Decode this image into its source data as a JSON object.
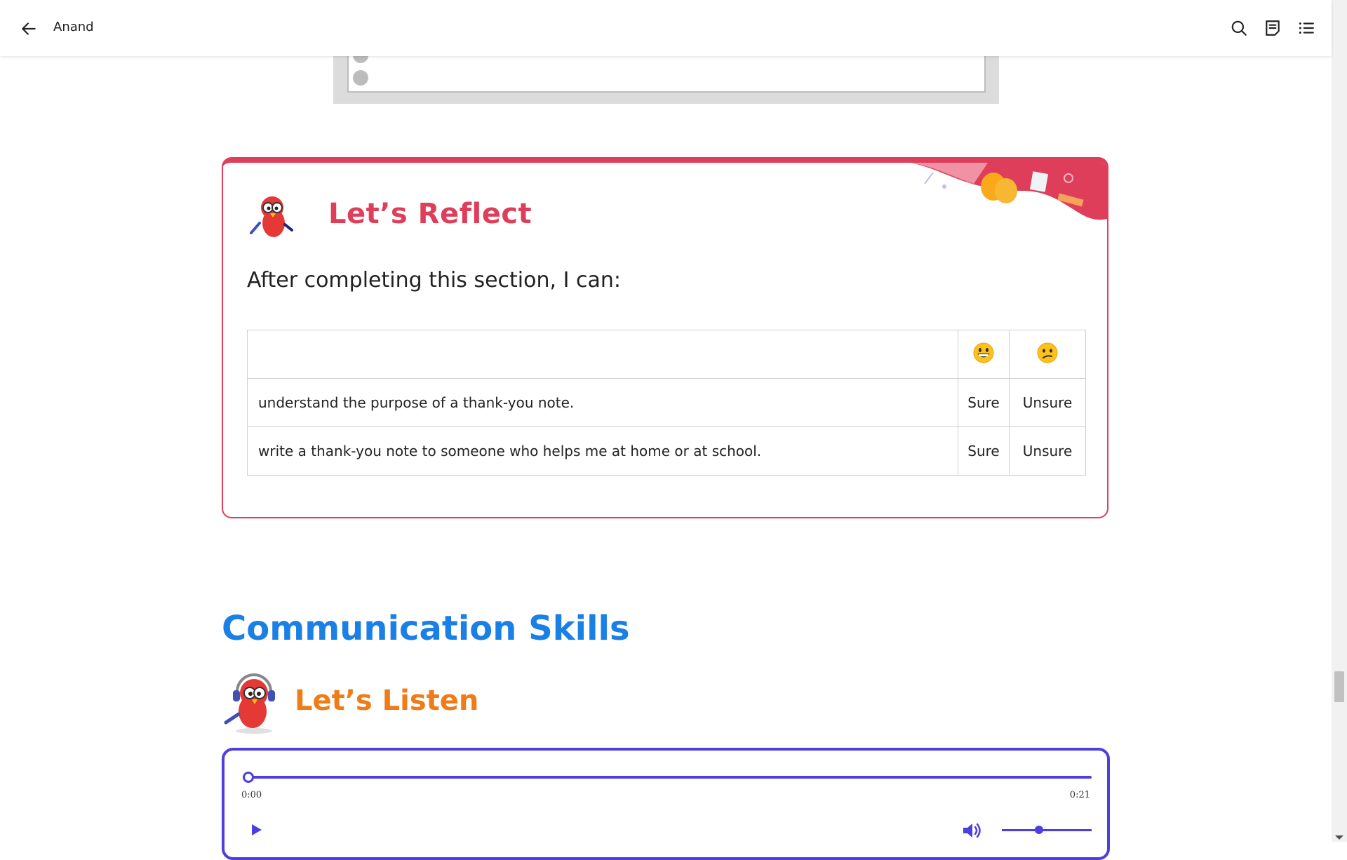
{
  "header": {
    "title": "Anand",
    "icons": [
      "back-arrow-icon",
      "search-icon",
      "notes-icon",
      "table-of-contents-icon"
    ]
  },
  "reflect": {
    "heading": "Let’s Reflect",
    "lead": "After completing this section, I can:",
    "header_icons": [
      "grinning-face-emoji",
      "confused-face-emoji"
    ],
    "rows": [
      {
        "text": "understand the purpose of a thank-you note.",
        "sure": "Sure",
        "unsure": "Unsure"
      },
      {
        "text": "write a thank-you note to someone who helps me at home or at school.",
        "sure": "Sure",
        "unsure": "Unsure"
      }
    ]
  },
  "communication": {
    "heading": "Communication Skills",
    "listen_heading": "Let’s Listen"
  },
  "player": {
    "current_time": "0:00",
    "duration": "0:21",
    "progress": 0,
    "volume": 0.4
  }
}
